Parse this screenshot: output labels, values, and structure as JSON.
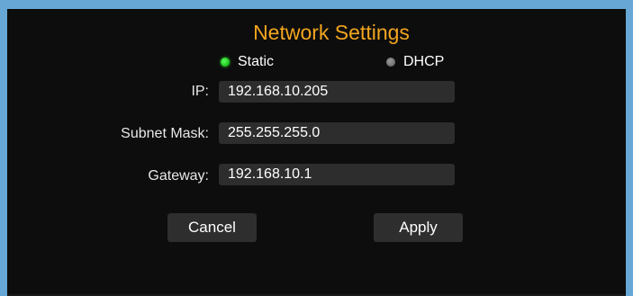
{
  "panel": {
    "title": "Network Settings",
    "title_color": "#f3a51f"
  },
  "mode": {
    "options": [
      {
        "label": "Static",
        "selected": true
      },
      {
        "label": "DHCP",
        "selected": false
      }
    ],
    "selected_color": "#22c922",
    "unselected_color": "#6f6f6f"
  },
  "fields": {
    "ip": {
      "label": "IP:",
      "value": "192.168.10.205"
    },
    "subnet": {
      "label": "Subnet Mask:",
      "value": "255.255.255.0"
    },
    "gateway": {
      "label": "Gateway:",
      "value": "192.168.10.1"
    }
  },
  "buttons": {
    "cancel_label": "Cancel",
    "apply_label": "Apply"
  },
  "colors": {
    "frame": "#66a7d6",
    "background": "#0d0d0d",
    "field_bg": "#2d2d2d",
    "button_bg": "#2e2e2e"
  }
}
